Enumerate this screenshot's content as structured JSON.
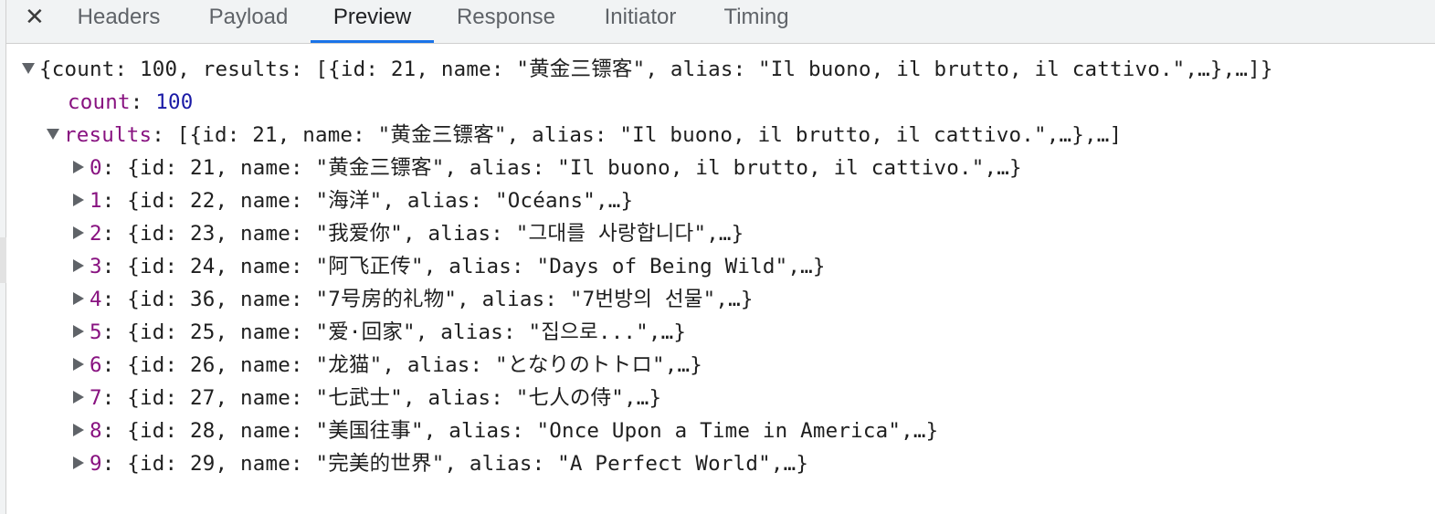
{
  "tabs": {
    "close_glyph": "✕",
    "items": [
      "Headers",
      "Payload",
      "Preview",
      "Response",
      "Initiator",
      "Timing"
    ],
    "active": "Preview"
  },
  "preview": {
    "root_summary": "{count: 100, results: [{id: 21, name: \"黄金三镖客\", alias: \"Il buono, il brutto, il cattivo.\",…},…]}",
    "count_key": "count",
    "count_value": "100",
    "results_key": "results",
    "results_summary": "[{id: 21, name: \"黄金三镖客\", alias: \"Il buono, il brutto, il cattivo.\",…},…]",
    "items": [
      {
        "index": "0",
        "summary": "{id: 21, name: \"黄金三镖客\", alias: \"Il buono, il brutto, il cattivo.\",…}"
      },
      {
        "index": "1",
        "summary": "{id: 22, name: \"海洋\", alias: \"Océans\",…}"
      },
      {
        "index": "2",
        "summary": "{id: 23, name: \"我爱你\", alias: \"그대를 사랑합니다\",…}"
      },
      {
        "index": "3",
        "summary": "{id: 24, name: \"阿飞正传\", alias: \"Days of Being Wild\",…}"
      },
      {
        "index": "4",
        "summary": "{id: 36, name: \"7号房的礼物\", alias: \"7번방의 선물\",…}"
      },
      {
        "index": "5",
        "summary": "{id: 25, name: \"爱·回家\", alias: \"집으로...\",…}"
      },
      {
        "index": "6",
        "summary": "{id: 26, name: \"龙猫\", alias: \"となりのトトロ\",…}"
      },
      {
        "index": "7",
        "summary": "{id: 27, name: \"七武士\", alias: \"七人の侍\",…}"
      },
      {
        "index": "8",
        "summary": "{id: 28, name: \"美国往事\", alias: \"Once Upon a Time in America\",…}"
      },
      {
        "index": "9",
        "summary": "{id: 29, name: \"完美的世界\", alias: \"A Perfect World\",…}"
      }
    ]
  }
}
